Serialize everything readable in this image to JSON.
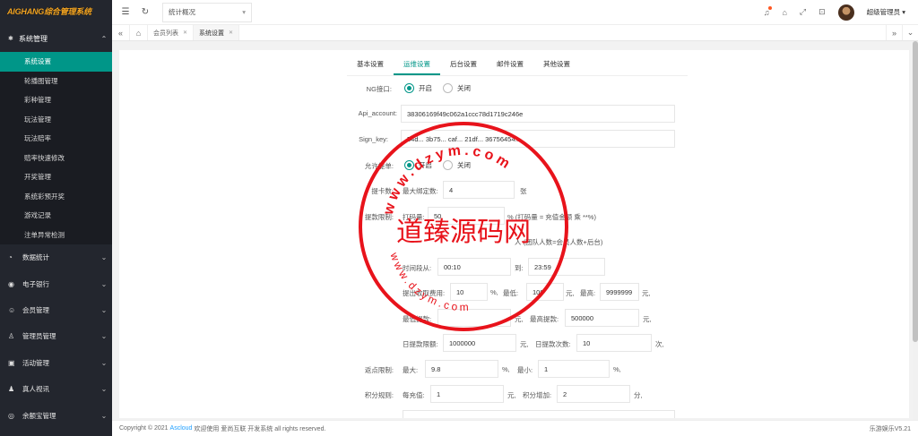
{
  "app": {
    "brand": "AIGHANG综合管理系统"
  },
  "sidebar": {
    "active_group": {
      "label": "系统管理",
      "icon": "gear-icon"
    },
    "sub_items": [
      "系统设置",
      "轮播图管理",
      "彩种管理",
      "玩法管理",
      "玩法赔率",
      "赔率快速修改",
      "开奖管理",
      "系统彩预开奖",
      "游戏记录",
      "注单异常检测"
    ],
    "groups": [
      {
        "label": "数据统计",
        "icon": "dashboard-icon"
      },
      {
        "label": "电子银行",
        "icon": "bank-icon"
      },
      {
        "label": "会员管理",
        "icon": "members-icon"
      },
      {
        "label": "管理员管理",
        "icon": "admin-icon"
      },
      {
        "label": "活动管理",
        "icon": "gift-icon"
      },
      {
        "label": "真人视讯",
        "icon": "video-icon"
      },
      {
        "label": "余额宝管理",
        "icon": "wallet-icon"
      }
    ]
  },
  "header": {
    "select_value": "统计概况",
    "user": "超级管理员"
  },
  "page_tabs": [
    "会员列表",
    "系统设置"
  ],
  "settings_tabs": [
    "基本设置",
    "运维设置",
    "后台设置",
    "邮件设置",
    "其他设置"
  ],
  "form": {
    "ng_label": "NG接口:",
    "radio_on": "开启",
    "radio_off": "关闭",
    "api_label": "Api_account:",
    "api_value": "38306169f49c062a1ccc78d1719c246e",
    "sign_label": "Sign_key:",
    "sign_value": "54d... 3b75... caf... 21df... 36756454....",
    "allow_label": "允许提单:",
    "bind_label": "提卡数:",
    "bind_text": "最大绑定数:",
    "bind_value": "4",
    "bind_unit": "张",
    "limit_label": "提款限制:",
    "code_text": "打码量:",
    "code_value": "50",
    "code_note": "% (打码量 = 充值金额 乘 **%)",
    "team_note": "人 (团队人数=会员人数+后台)",
    "time_text": "时间段从:",
    "time_from": "00:10",
    "time_to_text": "到:",
    "time_to": "23:59",
    "fee_text": "提出收取费用:",
    "fee_value": "10",
    "fee_unit": "%,",
    "min_text": "最低:",
    "min_value": "100",
    "min_unit": "元,",
    "max_text": "最高:",
    "max_value": "9999999",
    "max_unit": "元,",
    "low_text": "最低提款:",
    "low_unit": "元,",
    "high_text": "最高提款:",
    "high_value": "500000",
    "high_unit": "元,",
    "daily_amt_text": "日提款限额:",
    "daily_amt_value": "1000000",
    "daily_amt_unit": "元,",
    "daily_cnt_text": "日提款次数:",
    "daily_cnt_value": "10",
    "daily_cnt_unit": "次,",
    "rebate_label": "返点限制:",
    "rebate_max_text": "最大:",
    "rebate_max_value": "9.8",
    "rebate_max_unit": "%,",
    "rebate_min_text": "最小:",
    "rebate_min_value": "1",
    "rebate_min_unit": "%,",
    "points_label": "积分规则:",
    "points_text": "每充值:",
    "points_value": "1",
    "points_unit": "元,",
    "points_add_text": "积分增加:",
    "points_add_value": "2",
    "points_add_unit": "分,"
  },
  "footer": {
    "copyright": "Copyright © 2021",
    "link": "Ascloud",
    "rest": "欢迎使用 爱尚互联 开发系统 all rights reserved.",
    "version": "乐游娱乐V5.21"
  },
  "watermark": {
    "text": "道臻源码网",
    "arc_top": "www.dzym.com",
    "arc_bottom": "www.dzym.com",
    "color": "#e8131b"
  }
}
